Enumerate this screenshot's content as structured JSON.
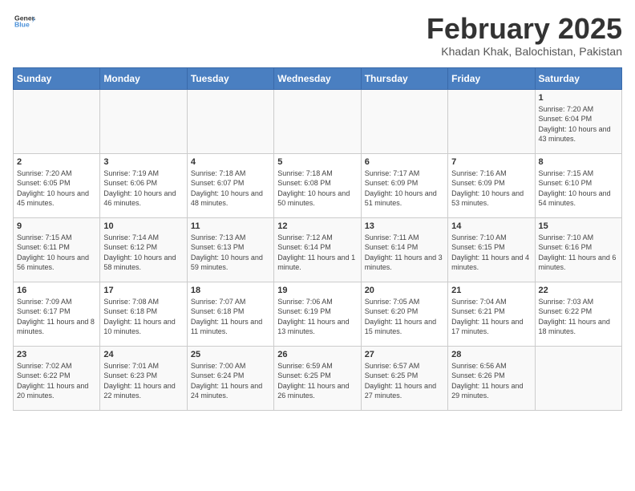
{
  "header": {
    "logo_general": "General",
    "logo_blue": "Blue",
    "title": "February 2025",
    "subtitle": "Khadan Khak, Balochistan, Pakistan"
  },
  "days_of_week": [
    "Sunday",
    "Monday",
    "Tuesday",
    "Wednesday",
    "Thursday",
    "Friday",
    "Saturday"
  ],
  "weeks": [
    [
      {
        "day": "",
        "info": ""
      },
      {
        "day": "",
        "info": ""
      },
      {
        "day": "",
        "info": ""
      },
      {
        "day": "",
        "info": ""
      },
      {
        "day": "",
        "info": ""
      },
      {
        "day": "",
        "info": ""
      },
      {
        "day": "1",
        "info": "Sunrise: 7:20 AM\nSunset: 6:04 PM\nDaylight: 10 hours and 43 minutes."
      }
    ],
    [
      {
        "day": "2",
        "info": "Sunrise: 7:20 AM\nSunset: 6:05 PM\nDaylight: 10 hours and 45 minutes."
      },
      {
        "day": "3",
        "info": "Sunrise: 7:19 AM\nSunset: 6:06 PM\nDaylight: 10 hours and 46 minutes."
      },
      {
        "day": "4",
        "info": "Sunrise: 7:18 AM\nSunset: 6:07 PM\nDaylight: 10 hours and 48 minutes."
      },
      {
        "day": "5",
        "info": "Sunrise: 7:18 AM\nSunset: 6:08 PM\nDaylight: 10 hours and 50 minutes."
      },
      {
        "day": "6",
        "info": "Sunrise: 7:17 AM\nSunset: 6:09 PM\nDaylight: 10 hours and 51 minutes."
      },
      {
        "day": "7",
        "info": "Sunrise: 7:16 AM\nSunset: 6:09 PM\nDaylight: 10 hours and 53 minutes."
      },
      {
        "day": "8",
        "info": "Sunrise: 7:15 AM\nSunset: 6:10 PM\nDaylight: 10 hours and 54 minutes."
      }
    ],
    [
      {
        "day": "9",
        "info": "Sunrise: 7:15 AM\nSunset: 6:11 PM\nDaylight: 10 hours and 56 minutes."
      },
      {
        "day": "10",
        "info": "Sunrise: 7:14 AM\nSunset: 6:12 PM\nDaylight: 10 hours and 58 minutes."
      },
      {
        "day": "11",
        "info": "Sunrise: 7:13 AM\nSunset: 6:13 PM\nDaylight: 10 hours and 59 minutes."
      },
      {
        "day": "12",
        "info": "Sunrise: 7:12 AM\nSunset: 6:14 PM\nDaylight: 11 hours and 1 minute."
      },
      {
        "day": "13",
        "info": "Sunrise: 7:11 AM\nSunset: 6:14 PM\nDaylight: 11 hours and 3 minutes."
      },
      {
        "day": "14",
        "info": "Sunrise: 7:10 AM\nSunset: 6:15 PM\nDaylight: 11 hours and 4 minutes."
      },
      {
        "day": "15",
        "info": "Sunrise: 7:10 AM\nSunset: 6:16 PM\nDaylight: 11 hours and 6 minutes."
      }
    ],
    [
      {
        "day": "16",
        "info": "Sunrise: 7:09 AM\nSunset: 6:17 PM\nDaylight: 11 hours and 8 minutes."
      },
      {
        "day": "17",
        "info": "Sunrise: 7:08 AM\nSunset: 6:18 PM\nDaylight: 11 hours and 10 minutes."
      },
      {
        "day": "18",
        "info": "Sunrise: 7:07 AM\nSunset: 6:18 PM\nDaylight: 11 hours and 11 minutes."
      },
      {
        "day": "19",
        "info": "Sunrise: 7:06 AM\nSunset: 6:19 PM\nDaylight: 11 hours and 13 minutes."
      },
      {
        "day": "20",
        "info": "Sunrise: 7:05 AM\nSunset: 6:20 PM\nDaylight: 11 hours and 15 minutes."
      },
      {
        "day": "21",
        "info": "Sunrise: 7:04 AM\nSunset: 6:21 PM\nDaylight: 11 hours and 17 minutes."
      },
      {
        "day": "22",
        "info": "Sunrise: 7:03 AM\nSunset: 6:22 PM\nDaylight: 11 hours and 18 minutes."
      }
    ],
    [
      {
        "day": "23",
        "info": "Sunrise: 7:02 AM\nSunset: 6:22 PM\nDaylight: 11 hours and 20 minutes."
      },
      {
        "day": "24",
        "info": "Sunrise: 7:01 AM\nSunset: 6:23 PM\nDaylight: 11 hours and 22 minutes."
      },
      {
        "day": "25",
        "info": "Sunrise: 7:00 AM\nSunset: 6:24 PM\nDaylight: 11 hours and 24 minutes."
      },
      {
        "day": "26",
        "info": "Sunrise: 6:59 AM\nSunset: 6:25 PM\nDaylight: 11 hours and 26 minutes."
      },
      {
        "day": "27",
        "info": "Sunrise: 6:57 AM\nSunset: 6:25 PM\nDaylight: 11 hours and 27 minutes."
      },
      {
        "day": "28",
        "info": "Sunrise: 6:56 AM\nSunset: 6:26 PM\nDaylight: 11 hours and 29 minutes."
      },
      {
        "day": "",
        "info": ""
      }
    ]
  ]
}
